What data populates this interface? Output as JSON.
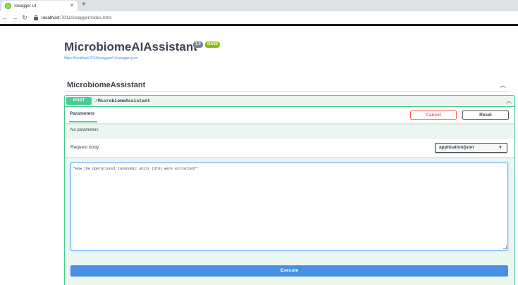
{
  "browser": {
    "tab_title": "Swagger UI",
    "tab_close": "✕",
    "new_tab": "+",
    "url_host": "localhost",
    "url_path": ":7011/swagger/index.html"
  },
  "info": {
    "title": "MicrobiomeAIAssistant",
    "version": "1.0",
    "oas": "OAS3",
    "spec_link": "https://localhost:7011/swagger/v1/swagger.json"
  },
  "tag": {
    "name": "MicrobiomeAssistant"
  },
  "operation": {
    "method": "POST",
    "path": "/MicrobiomeAssistant",
    "parameters_tab": "Parameters",
    "cancel_label": "Cancel",
    "reset_label": "Reset",
    "no_parameters": "No parameters",
    "request_body_label": "Request body",
    "content_type": "application/json",
    "body_value": "\"How the operational taxonomic units (OTU) were extracted?\"",
    "execute_label": "Execute"
  },
  "colors": {
    "post_green": "#49cc90",
    "post_bg": "#ebf6f1",
    "execute_blue": "#4990e2",
    "cancel_red": "#ff6060",
    "oas_green": "#89bf04"
  },
  "icons": {
    "favicon": "swagger-favicon",
    "back": "arrow-left-icon",
    "forward": "arrow-right-icon",
    "reload": "reload-icon",
    "lock": "lock-icon",
    "collapse": "chevron-up-icon",
    "select_arrow": "chevron-down-icon"
  }
}
